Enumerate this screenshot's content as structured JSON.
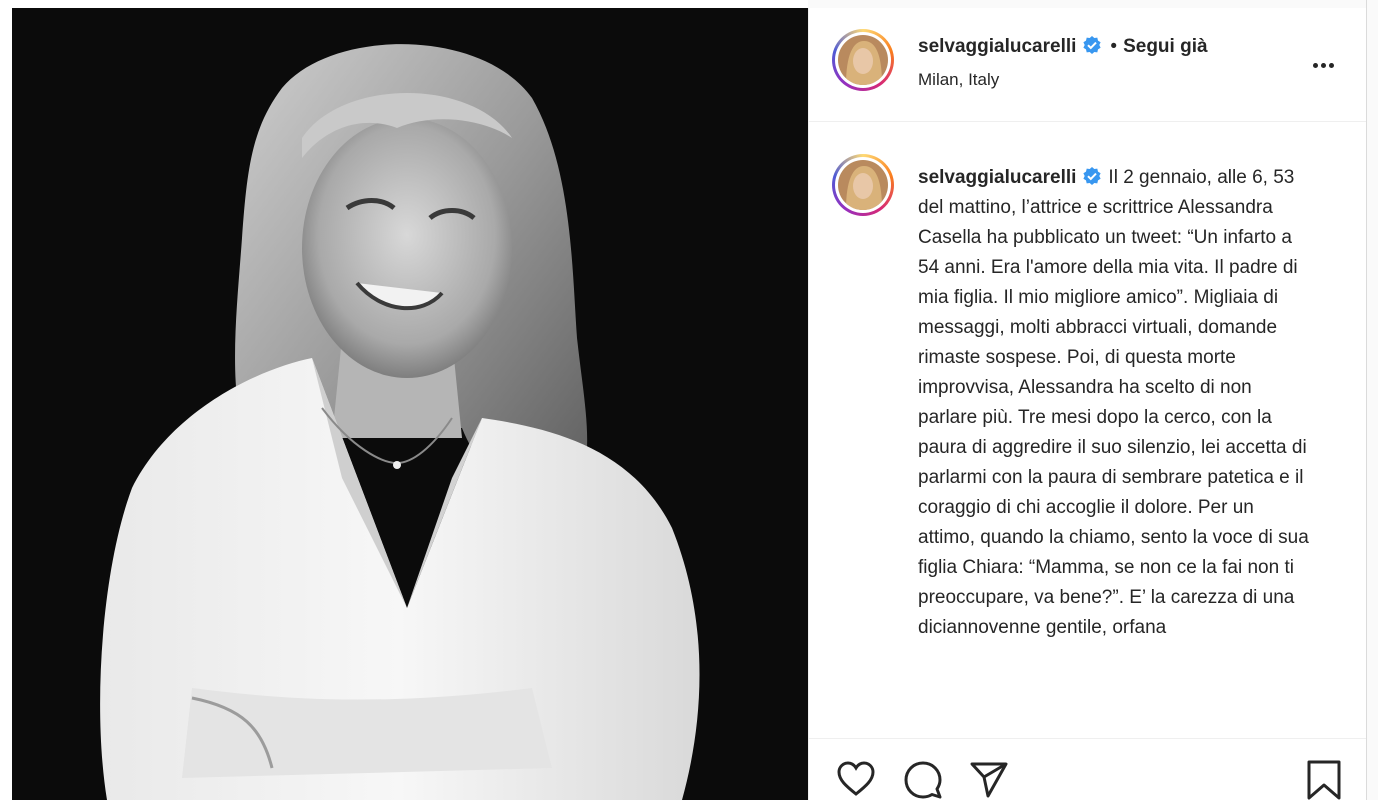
{
  "post": {
    "author": "selvaggialucarelli",
    "verified": true,
    "dot": "•",
    "follow_label": "Segui già",
    "location": "Milan, Italy"
  },
  "caption": {
    "username": "selvaggialucarelli",
    "text": "Il 2 gennaio, alle 6, 53 del mattino, l’attrice e scrittrice Alessandra Casella ha pubblicato un tweet: “Un infarto a 54 anni. Era l'amore della mia vita. Il padre di mia figlia. Il mio migliore amico”. Migliaia di messaggi, molti abbracci virtuali, domande rimaste sospese. Poi, di questa morte improvvisa, Alessandra ha scelto di non parlare più. Tre mesi dopo la cerco, con la paura di aggredire il suo silenzio, lei accetta di parlarmi con la paura di sembrare patetica e il coraggio di chi accoglie il dolore. Per un attimo, quando la chiamo, sento la voce di sua figlia Chiara: “Mamma, se non ce la fai non ti preoccupare, va bene?”. E’ la carezza di una diciannovenne gentile, orfana"
  },
  "icons": {
    "verified": "verified-badge-icon",
    "more": "more-options-icon",
    "like": "heart-icon",
    "comment": "comment-icon",
    "share": "paper-plane-icon",
    "save": "bookmark-icon"
  },
  "colors": {
    "verified_blue": "#3897f0",
    "text": "#262626",
    "photo_bg": "#0b0b0b"
  }
}
